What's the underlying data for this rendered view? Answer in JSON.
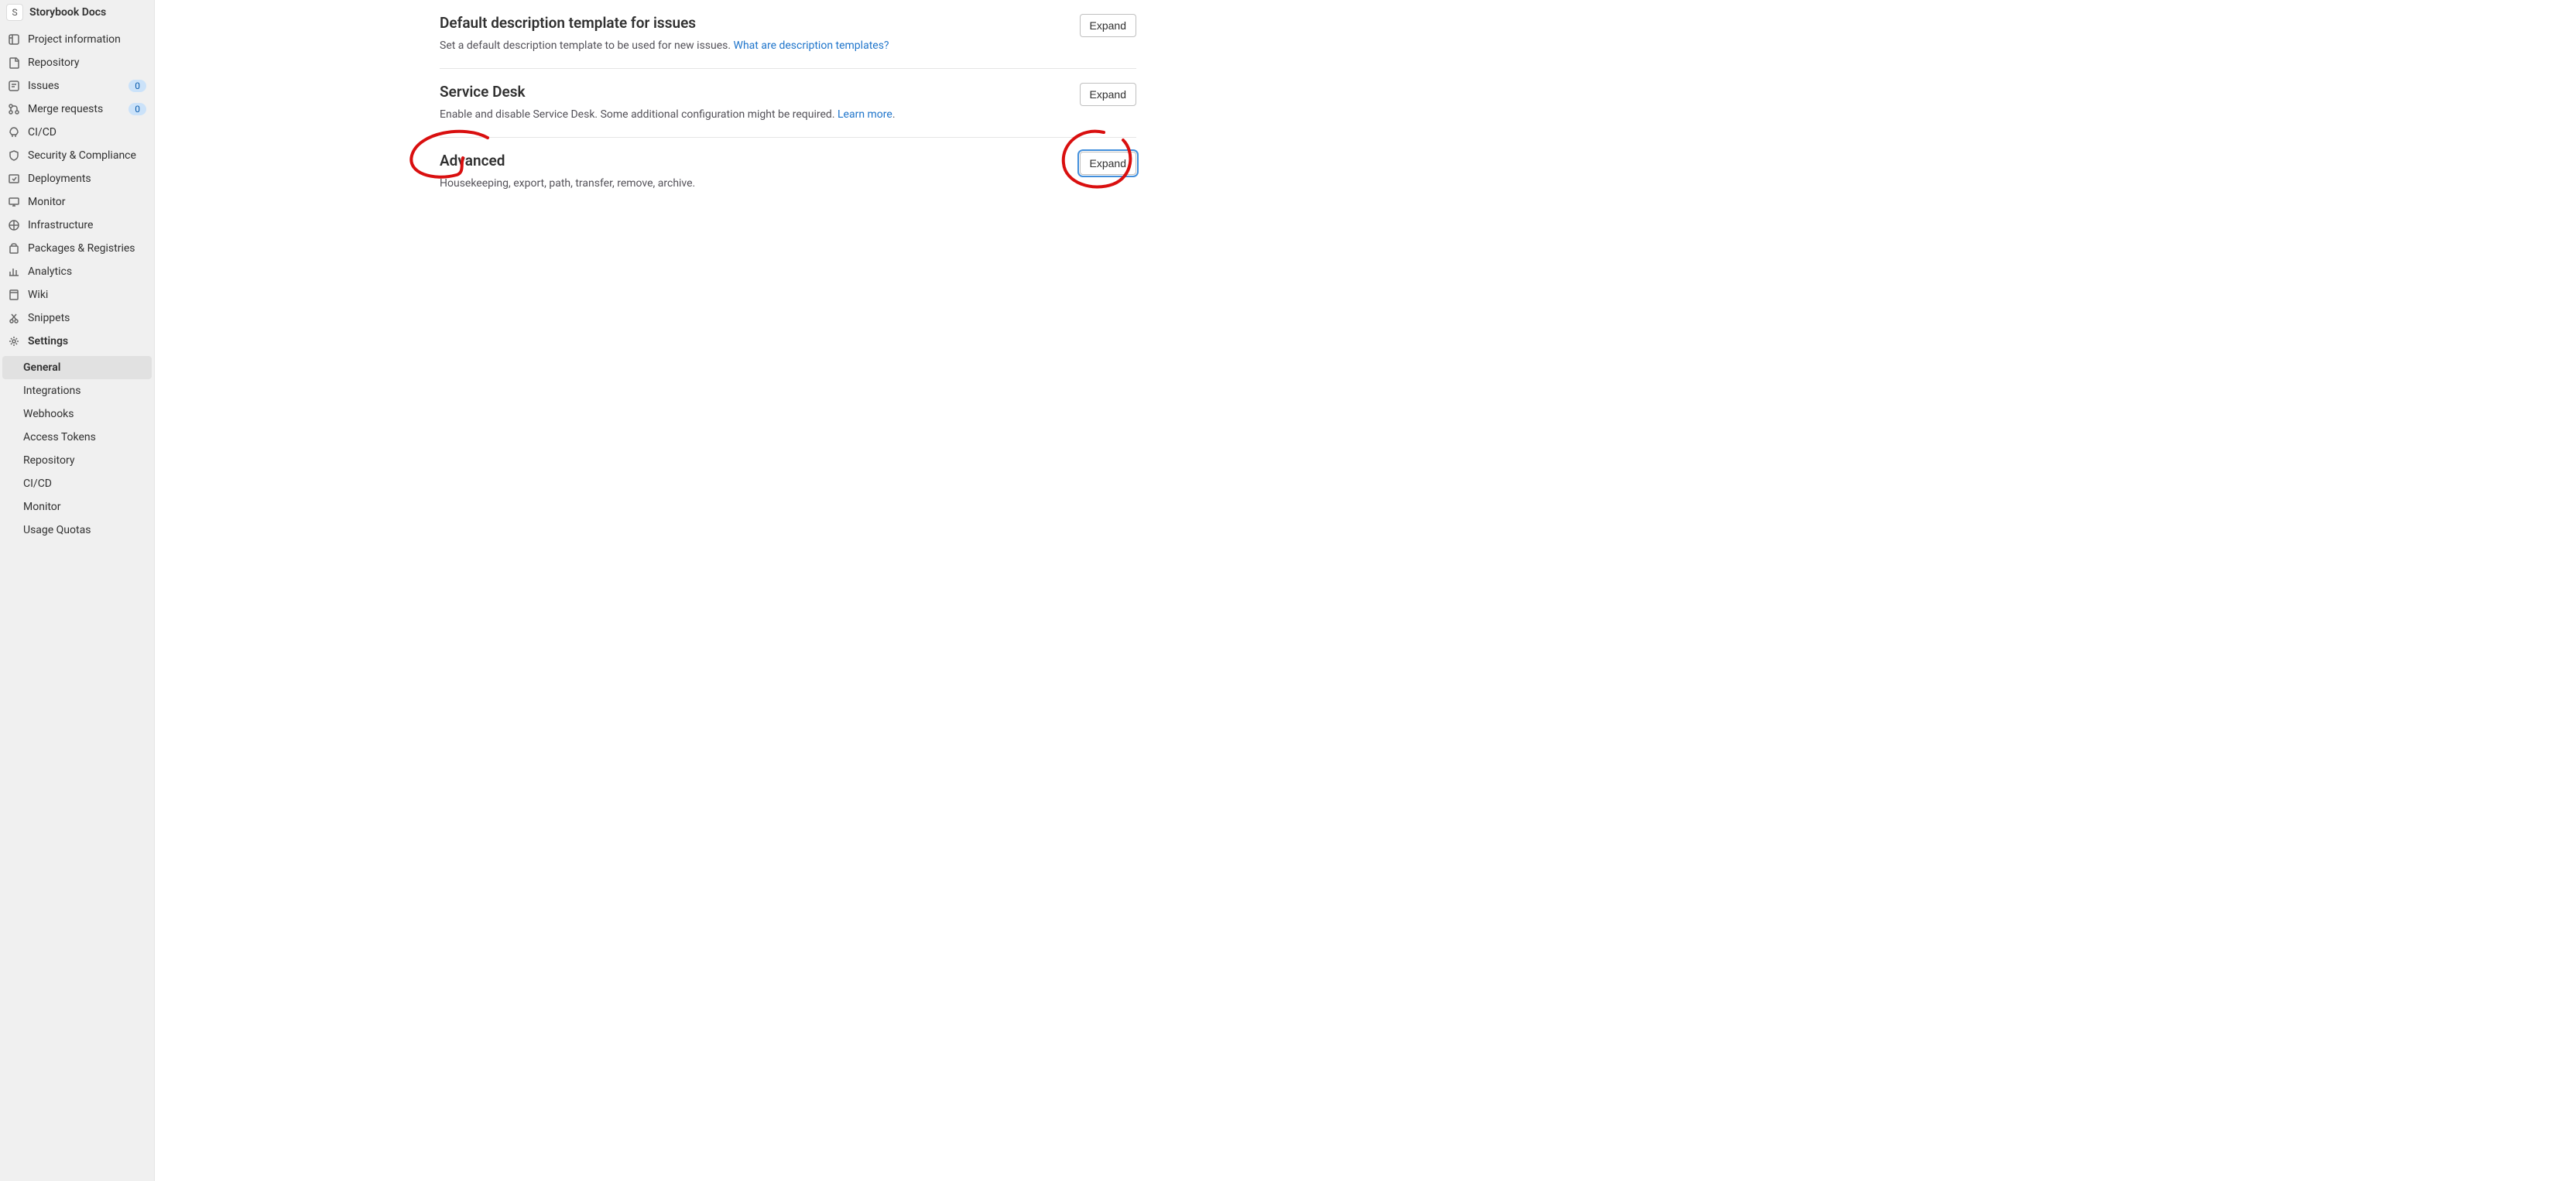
{
  "sidebar": {
    "avatar_letter": "S",
    "title": "Storybook Docs",
    "items": [
      {
        "label": "Project information",
        "icon": "info"
      },
      {
        "label": "Repository",
        "icon": "repo"
      },
      {
        "label": "Issues",
        "icon": "issues",
        "badge": "0"
      },
      {
        "label": "Merge requests",
        "icon": "merge",
        "badge": "0"
      },
      {
        "label": "CI/CD",
        "icon": "rocket"
      },
      {
        "label": "Security & Compliance",
        "icon": "shield"
      },
      {
        "label": "Deployments",
        "icon": "deploy"
      },
      {
        "label": "Monitor",
        "icon": "monitor"
      },
      {
        "label": "Infrastructure",
        "icon": "infra"
      },
      {
        "label": "Packages & Registries",
        "icon": "package"
      },
      {
        "label": "Analytics",
        "icon": "analytics"
      },
      {
        "label": "Wiki",
        "icon": "wiki"
      },
      {
        "label": "Snippets",
        "icon": "snippets"
      },
      {
        "label": "Settings",
        "icon": "settings",
        "bold": true
      }
    ],
    "subitems": [
      {
        "label": "General",
        "active": true
      },
      {
        "label": "Integrations"
      },
      {
        "label": "Webhooks"
      },
      {
        "label": "Access Tokens"
      },
      {
        "label": "Repository"
      },
      {
        "label": "CI/CD"
      },
      {
        "label": "Monitor"
      },
      {
        "label": "Usage Quotas"
      }
    ]
  },
  "sections": [
    {
      "title": "Default description template for issues",
      "desc_pre": "Set a default description template to be used for new issues. ",
      "link": "What are description templates?",
      "desc_post": "",
      "expand": "Expand"
    },
    {
      "title": "Service Desk",
      "desc_pre": "Enable and disable Service Desk. Some additional configuration might be required. ",
      "link": "Learn more",
      "desc_post": ".",
      "expand": "Expand"
    },
    {
      "title": "Advanced",
      "desc_pre": "Housekeeping, export, path, transfer, remove, archive.",
      "link": "",
      "desc_post": "",
      "expand": "Expand",
      "focused": true
    }
  ]
}
